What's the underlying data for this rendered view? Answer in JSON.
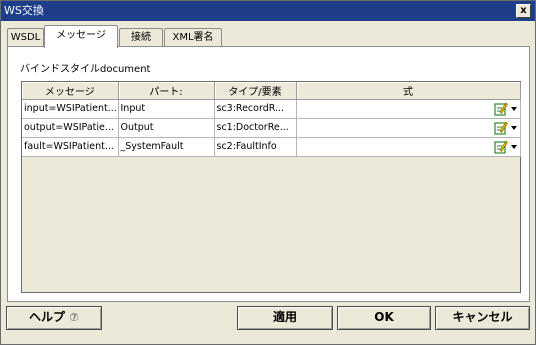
{
  "window": {
    "title": "WS交換",
    "close_label": "x"
  },
  "tabs": [
    {
      "label": "WSDL"
    },
    {
      "label": "メッセージ"
    },
    {
      "label": "接続"
    },
    {
      "label": "XML署名"
    }
  ],
  "binding": {
    "label": "バインドスタイル",
    "value": "document"
  },
  "table": {
    "columns": [
      "メッセージ",
      "パート:",
      "タイプ/要素",
      "式"
    ],
    "rows": [
      {
        "message": "input=WSIPatient...",
        "part": "Input",
        "type": "sc3:RecordR...",
        "expression": ""
      },
      {
        "message": "output=WSIPatie...",
        "part": "Output",
        "type": "sc1:DoctorRe...",
        "expression": ""
      },
      {
        "message": "fault=WSIPatient...",
        "part": "_SystemFault",
        "type": "sc2:FaultInfo",
        "expression": ""
      }
    ]
  },
  "buttons": {
    "help": "ヘルプ",
    "help_icon": "?",
    "apply": "適用",
    "ok": "OK",
    "cancel": "キャンセル"
  },
  "icons": {
    "row_edit": "edit-expression-icon",
    "row_menu": "dropdown-arrow-icon"
  },
  "colors": {
    "titlebar": "#1d3f8a",
    "dialog_bg": "#ece9d8",
    "icon_green": "#2c8a2c",
    "icon_yellow": "#e3b400"
  }
}
